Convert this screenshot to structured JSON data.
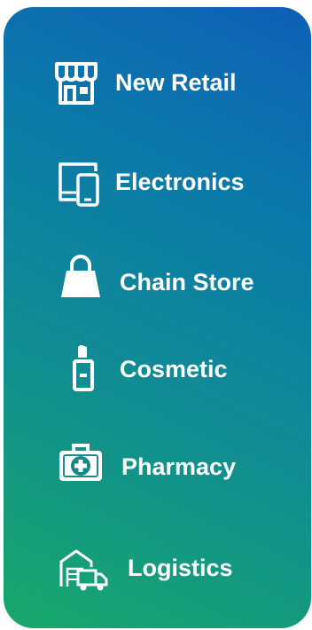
{
  "menu": {
    "items": [
      {
        "label": "New Retail",
        "icon": "storefront-icon"
      },
      {
        "label": "Electronics",
        "icon": "devices-icon"
      },
      {
        "label": "Chain Store",
        "icon": "shopping-bag-icon"
      },
      {
        "label": "Cosmetic",
        "icon": "lipstick-icon"
      },
      {
        "label": "Pharmacy",
        "icon": "first-aid-kit-icon"
      },
      {
        "label": "Logistics",
        "icon": "warehouse-truck-icon"
      }
    ]
  },
  "colors": {
    "gradient_top": "#0f5fb6",
    "gradient_bottom": "#18a86a",
    "text": "#ffffff"
  }
}
